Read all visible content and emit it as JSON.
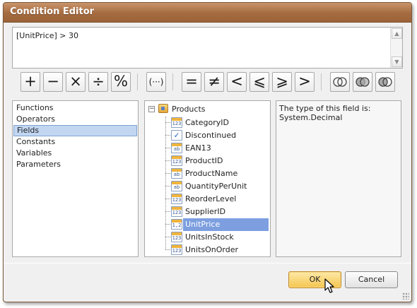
{
  "window": {
    "title": "Condition Editor"
  },
  "expression": {
    "text": "[UnitPrice] > 30"
  },
  "toolbar": {
    "buttons": [
      {
        "glyph": "+",
        "icon": "plus-icon"
      },
      {
        "glyph": "−",
        "icon": "minus-icon"
      },
      {
        "glyph": "×",
        "icon": "multiply-icon"
      },
      {
        "glyph": "÷",
        "icon": "divide-icon"
      },
      {
        "glyph": "%",
        "icon": "modulo-icon"
      },
      {
        "glyph": "(···)",
        "icon": "parentheses-icon"
      },
      {
        "glyph": "=",
        "icon": "equals-icon"
      },
      {
        "glyph": "≠",
        "icon": "not-equal-icon"
      },
      {
        "glyph": "<",
        "icon": "less-than-icon"
      },
      {
        "glyph": "⩽",
        "icon": "less-or-equal-icon"
      },
      {
        "glyph": "⩾",
        "icon": "greater-or-equal-icon"
      },
      {
        "glyph": ">",
        "icon": "greater-than-icon"
      },
      {
        "glyph": "",
        "icon": "and-circles-icon"
      },
      {
        "glyph": "",
        "icon": "or-circles-icon"
      },
      {
        "glyph": "",
        "icon": "not-circles-icon"
      }
    ]
  },
  "categories": {
    "items": [
      "Functions",
      "Operators",
      "Fields",
      "Constants",
      "Variables",
      "Parameters"
    ],
    "selected": "Fields"
  },
  "fields": {
    "root": "Products",
    "items": [
      {
        "name": "CategoryID",
        "type_icon": "123"
      },
      {
        "name": "Discontinued",
        "type_icon": "checkbox"
      },
      {
        "name": "EAN13",
        "type_icon": "ab"
      },
      {
        "name": "ProductID",
        "type_icon": "123"
      },
      {
        "name": "ProductName",
        "type_icon": "ab"
      },
      {
        "name": "QuantityPerUnit",
        "type_icon": "ab"
      },
      {
        "name": "ReorderLevel",
        "type_icon": "123"
      },
      {
        "name": "SupplierID",
        "type_icon": "123"
      },
      {
        "name": "UnitPrice",
        "type_icon": "1,2"
      },
      {
        "name": "UnitsInStock",
        "type_icon": "123"
      },
      {
        "name": "UnitsOnOrder",
        "type_icon": "123"
      }
    ],
    "selected": "UnitPrice"
  },
  "description": {
    "line1": "The type of this field is:",
    "line2": "System.Decimal"
  },
  "buttons": {
    "ok": "OK",
    "cancel": "Cancel"
  },
  "colors": {
    "title_bar": "#a56b40",
    "selection": "#7d9fe0",
    "category_selection": "#c2d6f2",
    "ok_button": "#f5c64e"
  }
}
